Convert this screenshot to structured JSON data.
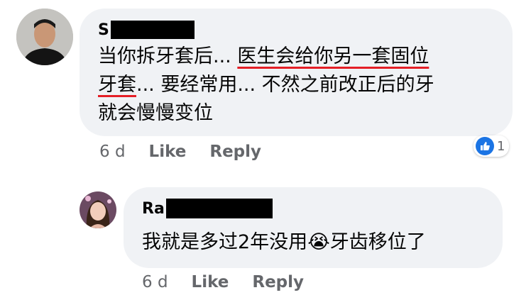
{
  "comment": {
    "author": "S",
    "text_line1_pre": "当你拆牙套后... ",
    "text_line1_ul": "医生会给你另一套固位",
    "text_line2_ul": "牙套",
    "text_line2_post": "... 要经常用... 不然之前改正后的牙",
    "text_line3": "就会慢慢变位",
    "time": "6 d",
    "like_label": "Like",
    "reply_label": "Reply",
    "reaction_count": "1"
  },
  "reply": {
    "author": "Ra",
    "text_pre": "我就是多过2年没用",
    "emoji": "😭",
    "text_post": "牙齿移位了",
    "time": "6 d",
    "like_label": "Like",
    "reply_label": "Reply"
  },
  "colors": {
    "bubble": "#f0f2f5",
    "like_blue": "#1b74e4",
    "underline_red": "#e41e26",
    "meta_gray": "#65676b"
  }
}
